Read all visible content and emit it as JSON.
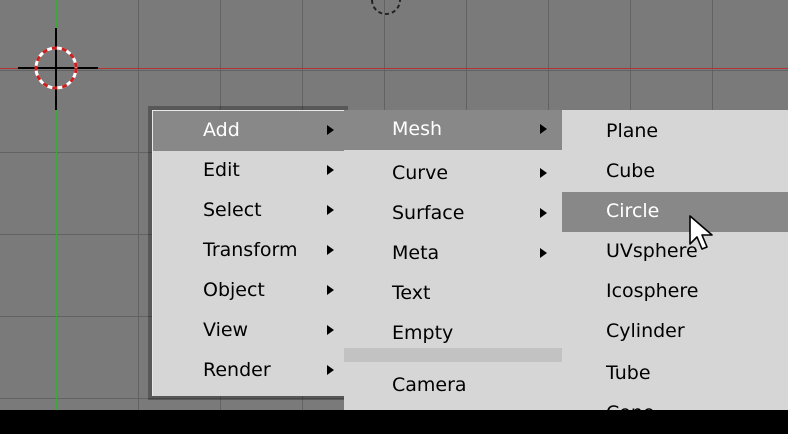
{
  "main_menu": {
    "items": [
      {
        "label": "Add",
        "has_submenu": true,
        "active": true
      },
      {
        "label": "Edit",
        "has_submenu": true
      },
      {
        "label": "Select",
        "has_submenu": true
      },
      {
        "label": "Transform",
        "has_submenu": true
      },
      {
        "label": "Object",
        "has_submenu": true
      },
      {
        "label": "View",
        "has_submenu": true
      },
      {
        "label": "Render",
        "has_submenu": true
      }
    ]
  },
  "add_menu": {
    "items": [
      {
        "label": "Mesh",
        "has_submenu": true,
        "active": true
      },
      {
        "label": "Curve",
        "has_submenu": true
      },
      {
        "label": "Surface",
        "has_submenu": true
      },
      {
        "label": "Meta",
        "has_submenu": true
      },
      {
        "label": "Text"
      },
      {
        "label": "Empty"
      },
      {
        "label": "Camera"
      }
    ]
  },
  "mesh_menu": {
    "items": [
      {
        "label": "Plane"
      },
      {
        "label": "Cube"
      },
      {
        "label": "Circle",
        "active": true
      },
      {
        "label": "UVsphere"
      },
      {
        "label": "Icosphere"
      },
      {
        "label": "Cylinder"
      },
      {
        "label": "Tube"
      },
      {
        "label": "Cone"
      }
    ]
  },
  "colors": {
    "viewport_bg": "#7a7a7a",
    "grid_line": "#626262",
    "x_axis": "#b53232",
    "y_axis": "#3ea83e",
    "menu_bg": "#d6d6d6",
    "menu_highlight": "#888888",
    "menu_highlight_text": "#ffffff"
  },
  "icons": [
    "3d-cursor-icon",
    "submenu-arrow-icon",
    "mouse-pointer-icon"
  ]
}
